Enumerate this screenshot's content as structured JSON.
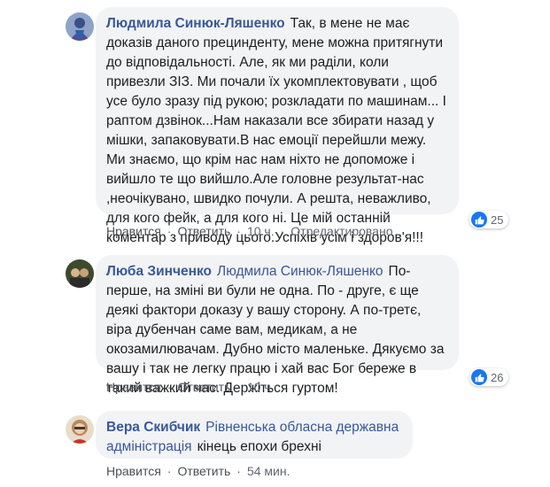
{
  "comments": [
    {
      "author": "Людмила Синюк-Ляшенко",
      "text": "Так, в мене не має доказів даного прецинденту, мене можна притягнути до відповідальності. Але, як ми раділи, коли привезли ЗІЗ. Ми почали їх укомплектовувати , щоб усе було зразу під рукою; розкладати по машинам... І раптом дзвінок...Нам наказали все збирати назад у мішки, запаковувати.В нас емоції перейшли межу. Ми знаємо, що крім нас нам ніхто не допоможе і вийшло те що вийшло.Але головне результат-нас ,неочікувано, швидко почули. А решта, неважливо, для кого фейк, а для кого ні. Це мій останній коментар з приводу цього.Успіхів усім і здоров'я!!!",
      "like_label": "Нравится",
      "reply_label": "Ответить",
      "time": "10 ч.",
      "edited": "Отредактировано",
      "reactions": "25",
      "avatar_icon": "user-avatar-icon",
      "accent": "#385898"
    },
    {
      "author": "Люба Зинченко",
      "mention": "Людмила Синюк-Ляшенко",
      "text": "По-перше, на зміні ви були не одна. По - друге, є ще деякі фактори доказу у вашу сторону. А по-третє, віра дубенчан саме вам, медикам, а не окозамилювачам. Дубно місто маленьке. Дякуємо за вашу і так не легку працю і хай вас Бог береже в такий важкий час. Держіться гуртом!",
      "like_label": "Нравится",
      "reply_label": "Ответить",
      "time": "10 ч.",
      "reactions": "26"
    },
    {
      "author": "Вера Скибчик",
      "mention": "Рівненська обласна державна адміністрація",
      "text": "кінець епохи брехні",
      "like_label": "Нравится",
      "reply_label": "Ответить",
      "time": "54 мин."
    }
  ],
  "colors": {
    "link": "#385898",
    "bubble": "#f2f3f5",
    "like": "#1877f2",
    "meta": "#606770"
  }
}
